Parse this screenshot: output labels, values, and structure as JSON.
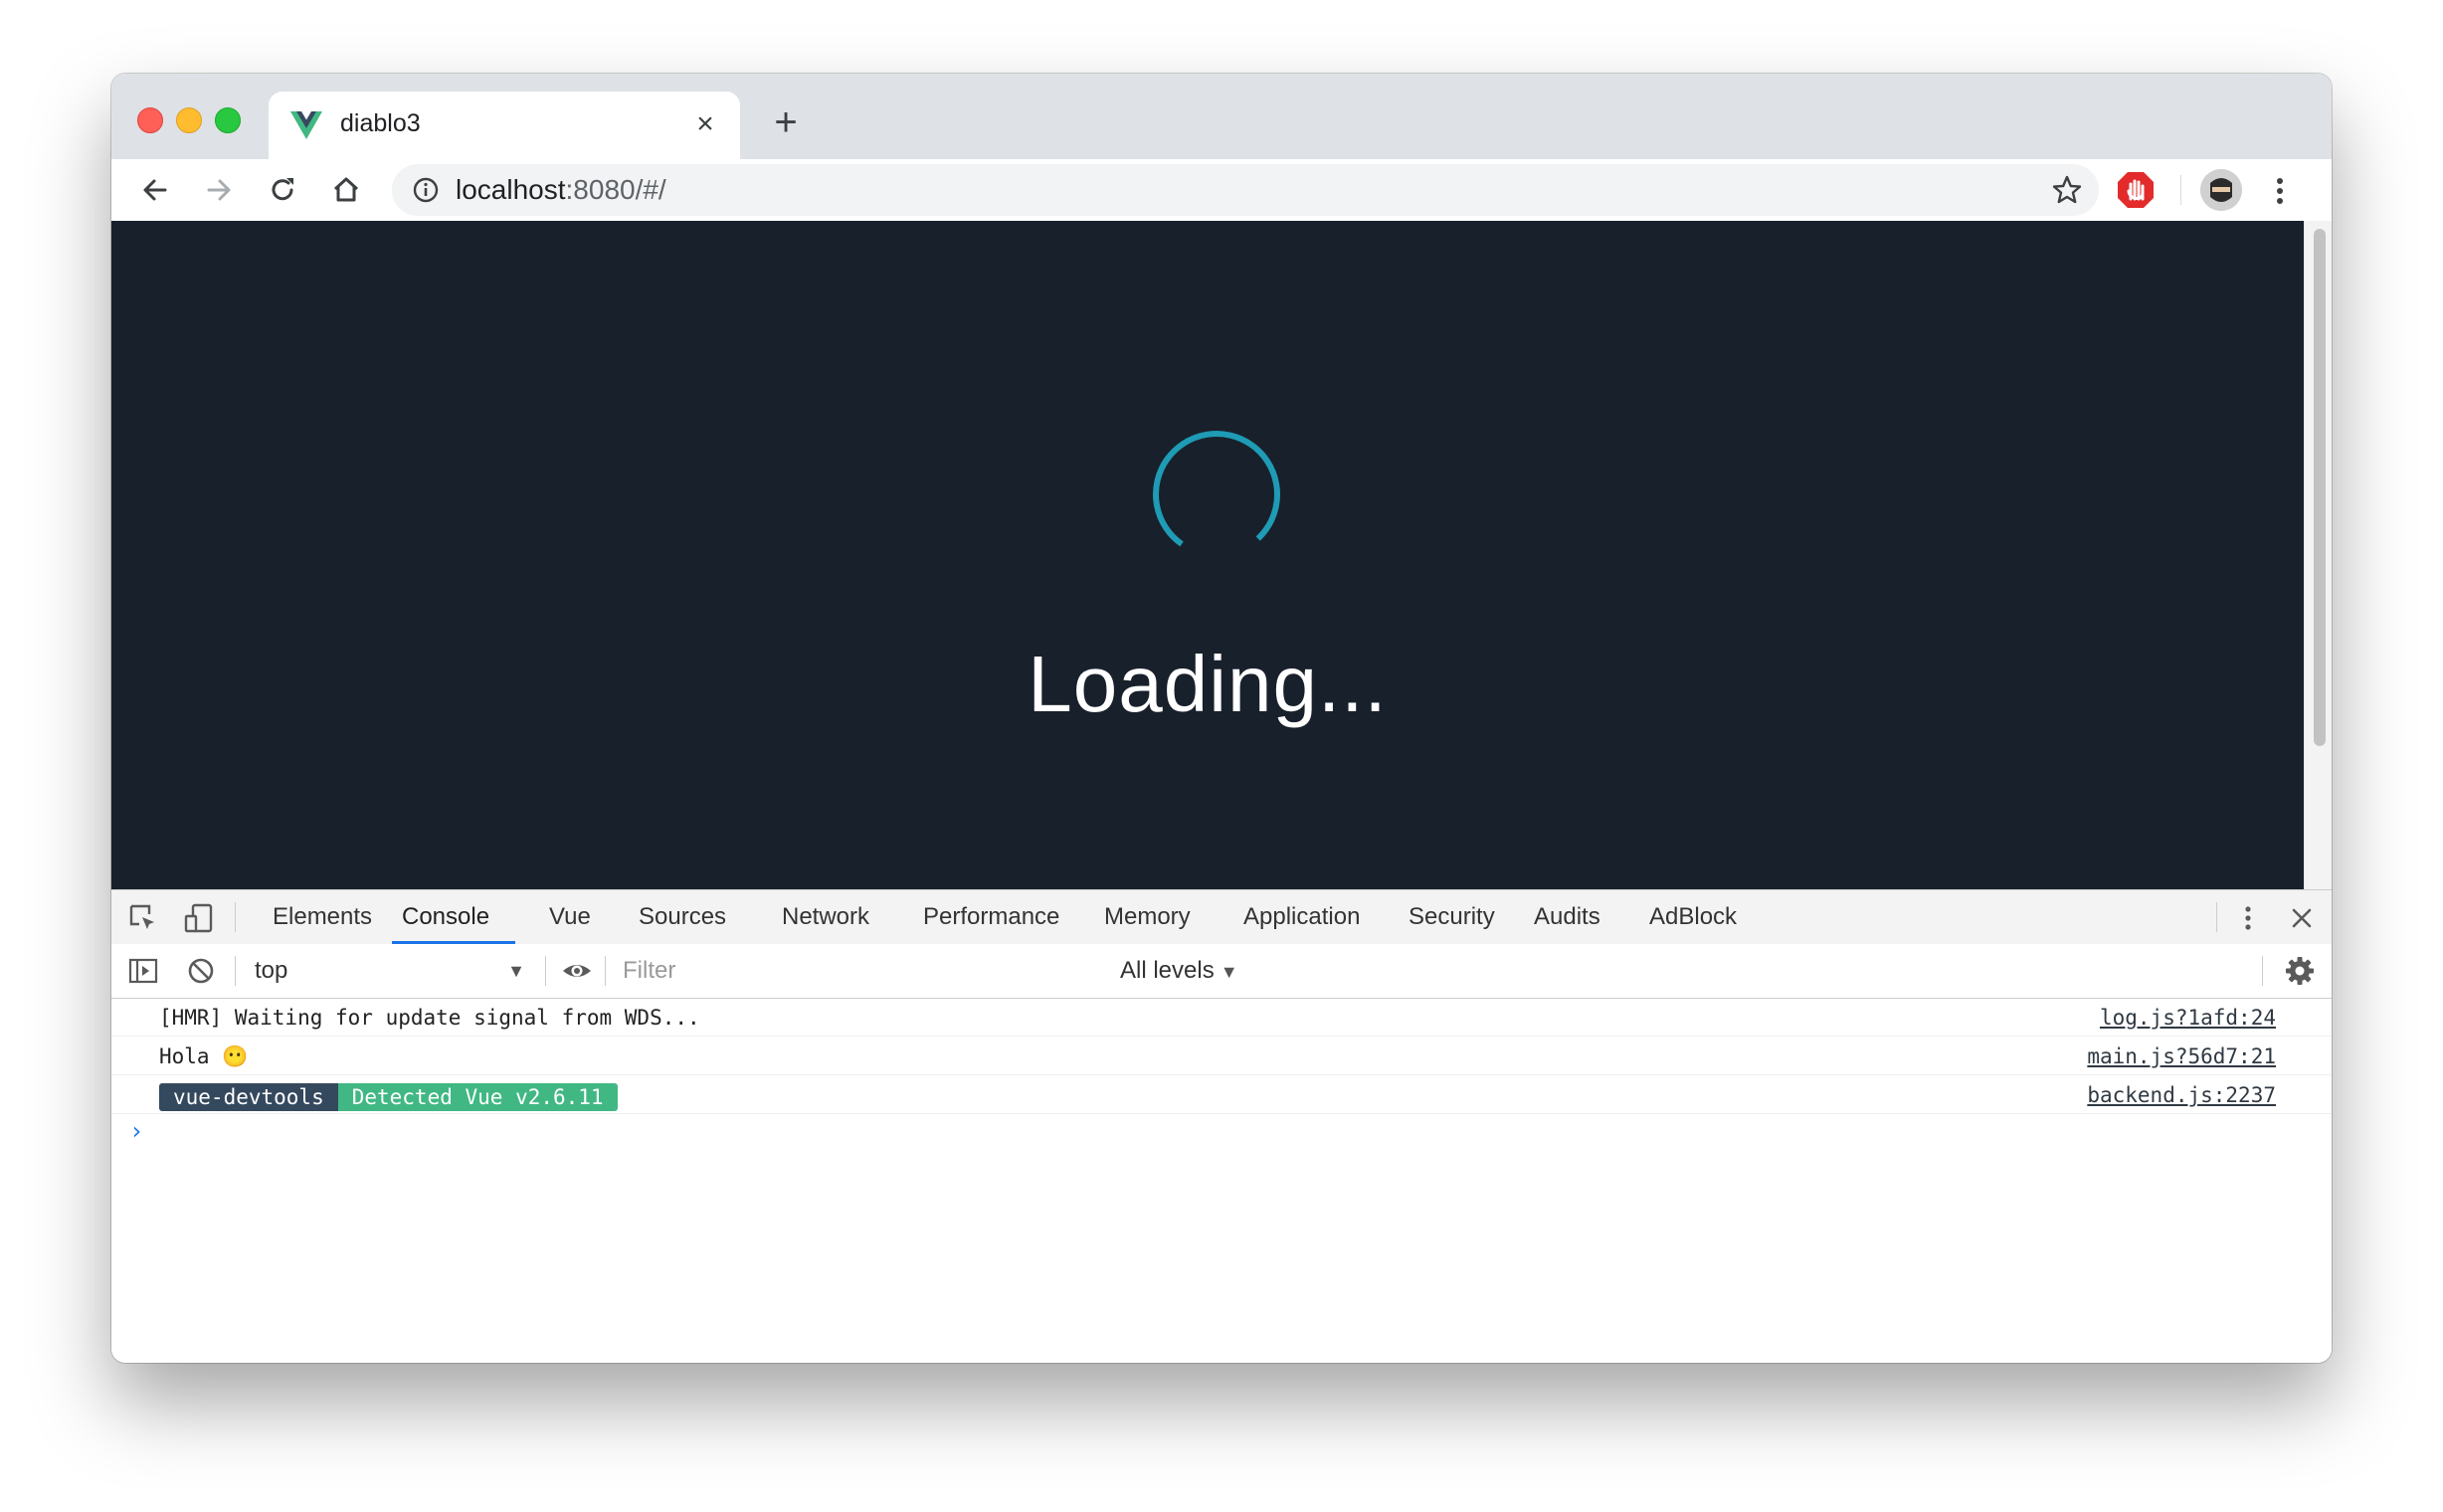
{
  "browser": {
    "tab": {
      "title": "diablo3",
      "close_label": "×"
    },
    "new_tab_label": "+",
    "address": {
      "host": "localhost",
      "rest": ":8080/#/"
    }
  },
  "page": {
    "loading_text": "Loading...",
    "spinner_color": "#1f9bb5",
    "background": "#18202b"
  },
  "devtools": {
    "tabs": [
      {
        "label": "Elements"
      },
      {
        "label": "Console"
      },
      {
        "label": "Vue"
      },
      {
        "label": "Sources"
      },
      {
        "label": "Network"
      },
      {
        "label": "Performance"
      },
      {
        "label": "Memory"
      },
      {
        "label": "Application"
      },
      {
        "label": "Security"
      },
      {
        "label": "Audits"
      },
      {
        "label": "AdBlock"
      }
    ],
    "active_tab": "Console",
    "console_toolbar": {
      "context": "top",
      "filter_placeholder": "Filter",
      "levels": "All levels"
    },
    "messages": [
      {
        "text": "[HMR] Waiting for update signal from WDS...",
        "source": "log.js?1afd:24"
      },
      {
        "text": "Hola 😶",
        "source": "main.js?56d7:21"
      },
      {
        "badge_left": "vue-devtools",
        "badge_right": "Detected Vue v2.6.11",
        "source": "backend.js:2237"
      }
    ],
    "prompt": "›"
  }
}
